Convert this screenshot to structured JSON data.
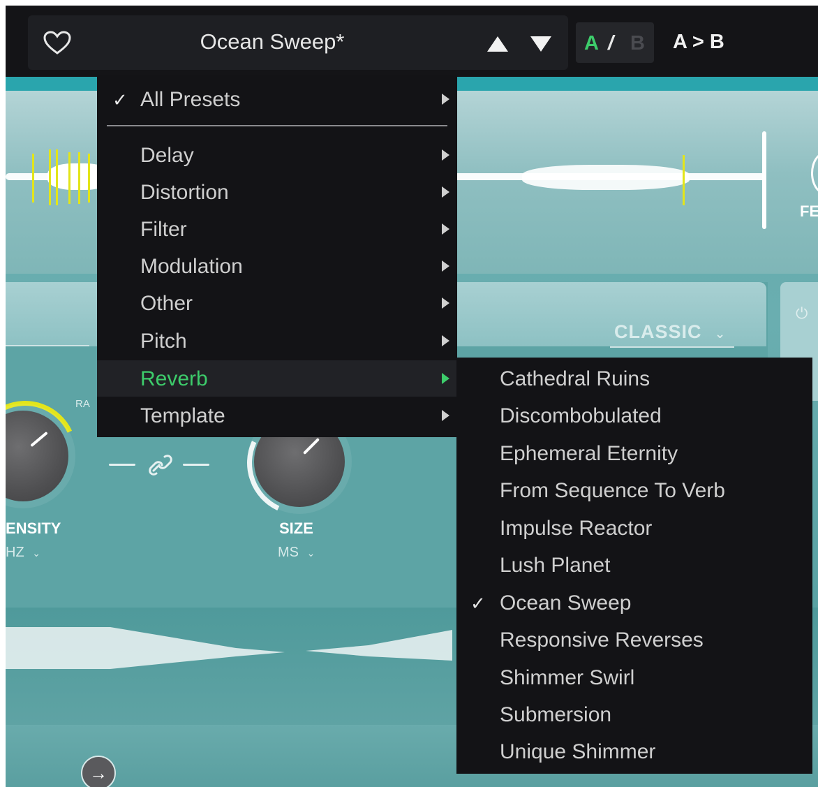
{
  "header": {
    "preset_name": "Ocean Sweep*",
    "ab_a": "A",
    "ab_slash": "/",
    "ab_b": "B",
    "copy_label": "A > B"
  },
  "panel": {
    "mode_label": "CLASSIC",
    "wave_side_label": "FE",
    "rate_label_fragment": "RA",
    "knobs": [
      {
        "name": "ENSITY",
        "unit": "HZ"
      },
      {
        "name": "SIZE",
        "unit": "MS"
      }
    ]
  },
  "menu": {
    "items": [
      {
        "label": "All Presets",
        "checked": true
      },
      {
        "label": "Delay"
      },
      {
        "label": "Distortion"
      },
      {
        "label": "Filter"
      },
      {
        "label": "Modulation"
      },
      {
        "label": "Other"
      },
      {
        "label": "Pitch"
      },
      {
        "label": "Reverb",
        "selected": true
      },
      {
        "label": "Template"
      }
    ],
    "check_glyph": "✓"
  },
  "submenu": {
    "items": [
      {
        "label": "Cathedral Ruins"
      },
      {
        "label": "Discombobulated"
      },
      {
        "label": "Ephemeral Eternity"
      },
      {
        "label": "From Sequence To Verb"
      },
      {
        "label": "Impulse Reactor"
      },
      {
        "label": "Lush Planet"
      },
      {
        "label": "Ocean Sweep",
        "checked": true
      },
      {
        "label": "Responsive Reverses"
      },
      {
        "label": "Shimmer Swirl"
      },
      {
        "label": "Submersion"
      },
      {
        "label": "Unique Shimmer"
      }
    ]
  },
  "colors": {
    "accent_green": "#3dcc6b",
    "menu_bg": "#131316",
    "teal": "#5fa6a8",
    "knob_arc_yellow": "#e3e51a"
  },
  "icons": {
    "favorite": "heart-icon",
    "prev": "triangle-up-icon",
    "next": "triangle-down-icon",
    "link": "link-icon",
    "power": "power-icon",
    "arrow": "arrow-right-icon"
  }
}
